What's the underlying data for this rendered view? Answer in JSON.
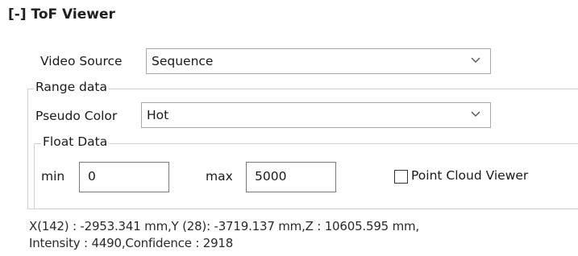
{
  "panel": {
    "title": "[-] ToF Viewer"
  },
  "video_source": {
    "label": "Video Source",
    "value": "Sequence",
    "icon": "chevron-down-icon"
  },
  "range_data": {
    "title": "Range data",
    "pseudo_color": {
      "label": "Pseudo Color",
      "value": "Hot",
      "icon": "chevron-down-icon"
    },
    "float_data": {
      "title": "Float Data",
      "min_label": "min",
      "min_value": "0",
      "max_label": "max",
      "max_value": "5000"
    },
    "point_cloud": {
      "label": "Point Cloud Viewer",
      "checked": false
    }
  },
  "readout": {
    "line1": "X(142) : -2953.341 mm,Y (28): -3719.137 mm,Z : 10605.595 mm,",
    "line2": "Intensity : 4490,Confidence : 2918"
  },
  "colors": {
    "border": "#a9a9a9",
    "group_border": "#d0d0d0",
    "text": "#1a1a1a"
  }
}
